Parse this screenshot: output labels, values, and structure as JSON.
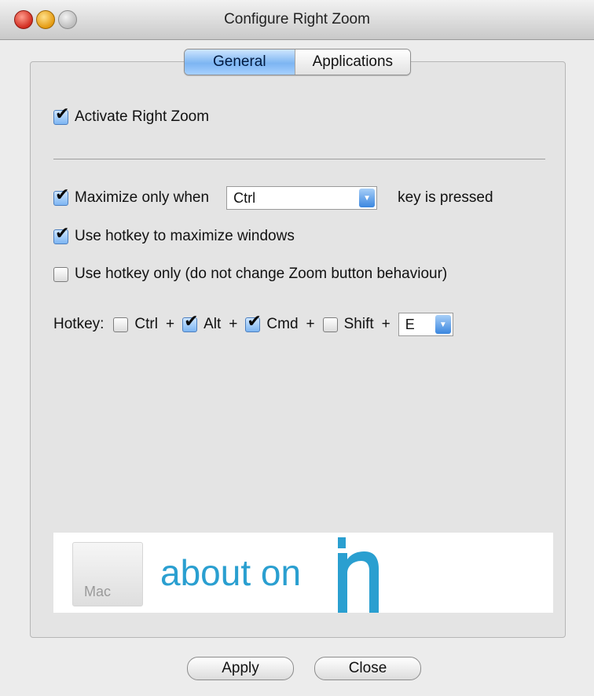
{
  "window": {
    "title": "Configure Right Zoom"
  },
  "tabs": [
    {
      "label": "General",
      "active": true
    },
    {
      "label": "Applications",
      "active": false
    }
  ],
  "general": {
    "activate": {
      "label": "Activate Right Zoom",
      "checked": true
    },
    "maximize_only": {
      "label": "Maximize only when",
      "select_value": "Ctrl",
      "suffix": "key is pressed",
      "checked": true
    },
    "use_hotkey": {
      "label": "Use hotkey to maximize windows",
      "checked": true
    },
    "hotkey_only": {
      "label": "Use hotkey only (do not change Zoom button behaviour)",
      "checked": false
    },
    "hotkey": {
      "label": "Hotkey:",
      "plus": "+",
      "modifiers": [
        {
          "label": "Ctrl",
          "checked": false
        },
        {
          "label": "Alt",
          "checked": true
        },
        {
          "label": "Cmd",
          "checked": true
        },
        {
          "label": "Shift",
          "checked": false
        }
      ],
      "key_value": "E"
    }
  },
  "banner": {
    "mac_label": "Mac",
    "brand_text": "about on"
  },
  "buttons": {
    "apply": "Apply",
    "close": "Close"
  },
  "colors": {
    "accent": "#7db5f2",
    "brand": "#2a9fd0"
  },
  "icons": {
    "check": "✔",
    "arrow": "▼",
    "apple": ""
  }
}
